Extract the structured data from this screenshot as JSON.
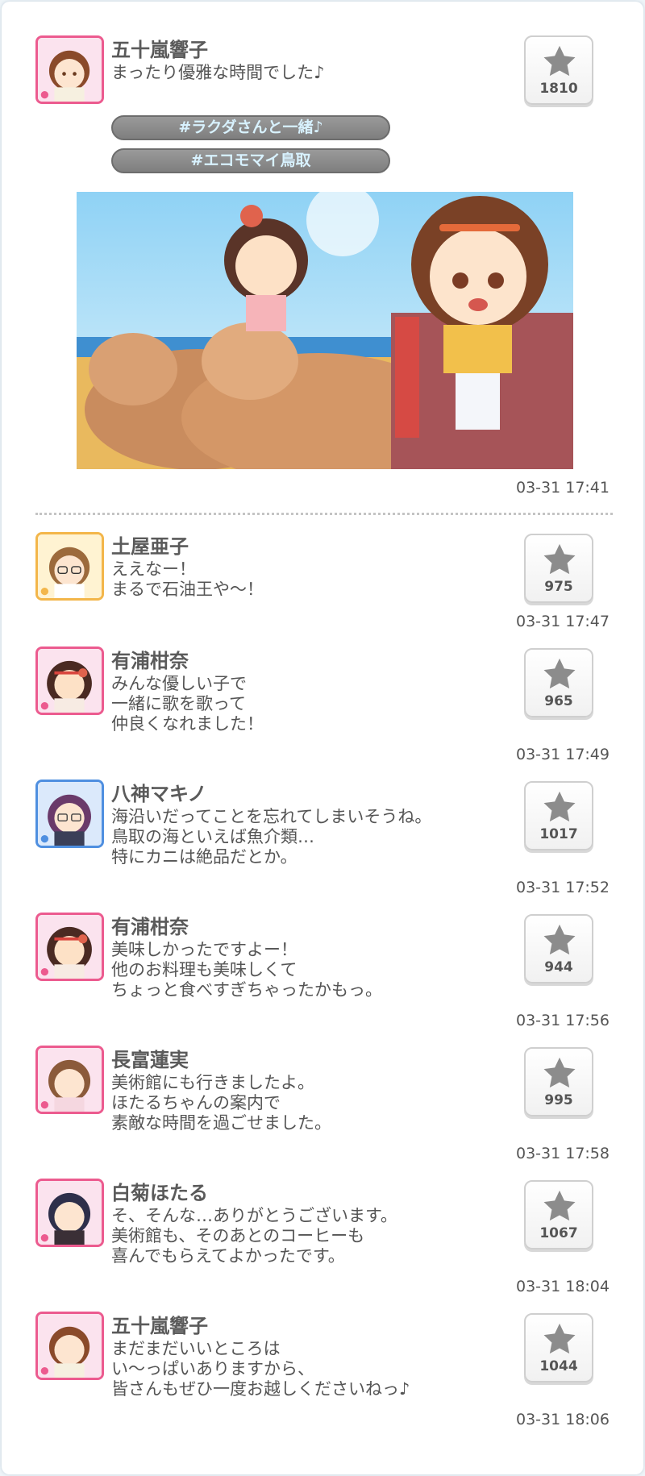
{
  "colors": {
    "pink_frame": "#ec5b8f",
    "yellow_frame": "#f3b64a",
    "blue_frame": "#4f8fe0",
    "tag_text": "#d8f2ff"
  },
  "main_post": {
    "name": "五十嵐響子",
    "message": "まったり優雅な時間でした♪",
    "tags": [
      "#ラクダさんと一緒♪",
      "#エコモマイ鳥取"
    ],
    "likes": "1810",
    "time": "03-31 17:41",
    "avatar_frame": "pink"
  },
  "replies": [
    {
      "name": "土屋亜子",
      "message": "ええなー！\nまるで石油王や〜！",
      "likes": "975",
      "time": "03-31 17:47",
      "avatar_frame": "yellow"
    },
    {
      "name": "有浦柑奈",
      "message": "みんな優しい子で\n一緒に歌を歌って\n仲良くなれました！",
      "likes": "965",
      "time": "03-31 17:49",
      "avatar_frame": "pink"
    },
    {
      "name": "八神マキノ",
      "message": "海沿いだってことを忘れてしまいそうね。\n鳥取の海といえば魚介類…\n特にカニは絶品だとか。",
      "likes": "1017",
      "time": "03-31 17:52",
      "avatar_frame": "blue"
    },
    {
      "name": "有浦柑奈",
      "message": "美味しかったですよー！\n他のお料理も美味しくて\nちょっと食べすぎちゃったかもっ。",
      "likes": "944",
      "time": "03-31 17:56",
      "avatar_frame": "pink"
    },
    {
      "name": "長富蓮実",
      "message": "美術館にも行きましたよ。\nほたるちゃんの案内で\n素敵な時間を過ごせました。",
      "likes": "995",
      "time": "03-31 17:58",
      "avatar_frame": "pink"
    },
    {
      "name": "白菊ほたる",
      "message": "そ、そんな…ありがとうございます。\n美術館も、そのあとのコーヒーも\n喜んでもらえてよかったです。",
      "likes": "1067",
      "time": "03-31 18:04",
      "avatar_frame": "pink"
    },
    {
      "name": "五十嵐響子",
      "message": "まだまだいいところは\nい〜っぱいありますから、\n皆さんもぜひ一度お越しくださいねっ♪",
      "likes": "1044",
      "time": "03-31 18:06",
      "avatar_frame": "pink"
    }
  ]
}
